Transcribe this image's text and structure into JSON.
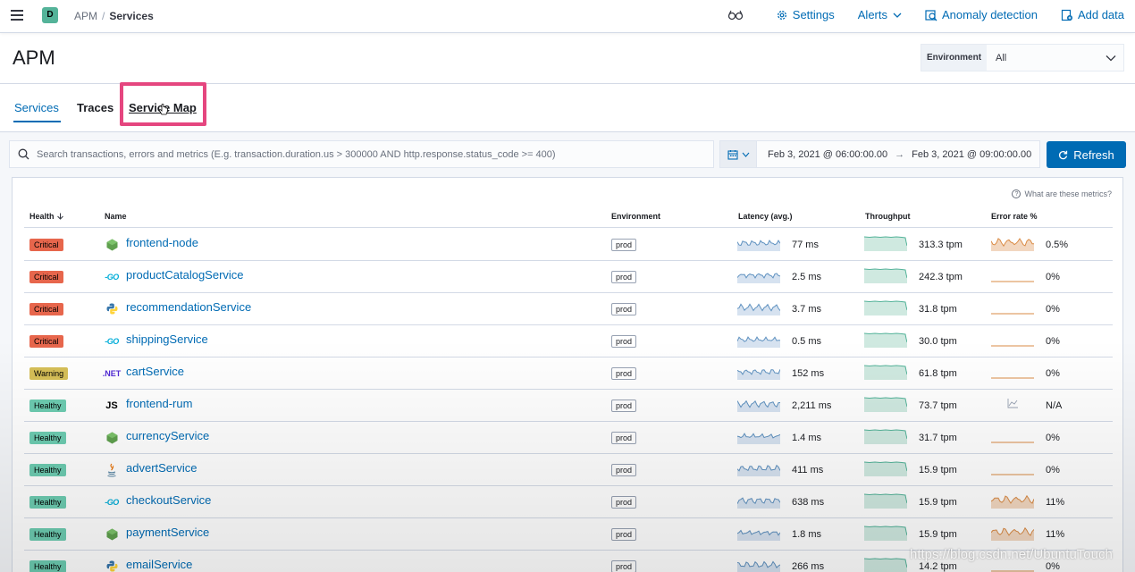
{
  "header": {
    "space_initial": "D",
    "breadcrumbs": [
      "APM",
      "Services"
    ],
    "settings": "Settings",
    "alerts": "Alerts",
    "anomaly": "Anomaly detection",
    "add_data": "Add data"
  },
  "page": {
    "title": "APM",
    "environment_label": "Environment",
    "environment_value": "All"
  },
  "tabs": {
    "services": "Services",
    "traces": "Traces",
    "service_map": "Service Map"
  },
  "search": {
    "placeholder": "Search transactions, errors and metrics (E.g. transaction.duration.us > 300000 AND http.response.status_code >= 400)"
  },
  "datepicker": {
    "start": "Feb 3, 2021 @ 06:00:00.00",
    "end": "Feb 3, 2021 @ 09:00:00.00"
  },
  "refresh_label": "Refresh",
  "metrics_help": "What are these metrics?",
  "table": {
    "columns": {
      "health": "Health",
      "name": "Name",
      "environment": "Environment",
      "latency": "Latency (avg.)",
      "throughput": "Throughput",
      "error_rate": "Error rate %"
    },
    "rows": [
      {
        "health": "Critical",
        "level": "critical",
        "icon": "nodejs-icon",
        "name": "frontend-node",
        "env": "prod",
        "latency": "77 ms",
        "throughput": "313.3 tpm",
        "error": "0.5%",
        "error_spark": "wave"
      },
      {
        "health": "Critical",
        "level": "critical",
        "icon": "go-icon",
        "name": "productCatalogService",
        "env": "prod",
        "latency": "2.5 ms",
        "throughput": "242.3 tpm",
        "error": "0%",
        "error_spark": "flat"
      },
      {
        "health": "Critical",
        "level": "critical",
        "icon": "python-icon",
        "name": "recommendationService",
        "env": "prod",
        "latency": "3.7 ms",
        "throughput": "31.8 tpm",
        "error": "0%",
        "error_spark": "flat"
      },
      {
        "health": "Critical",
        "level": "critical",
        "icon": "go-icon",
        "name": "shippingService",
        "env": "prod",
        "latency": "0.5 ms",
        "throughput": "30.0 tpm",
        "error": "0%",
        "error_spark": "flat"
      },
      {
        "health": "Warning",
        "level": "warning",
        "icon": "dotnet-icon",
        "name": "cartService",
        "env": "prod",
        "latency": "152 ms",
        "throughput": "61.8 tpm",
        "error": "0%",
        "error_spark": "flat"
      },
      {
        "health": "Healthy",
        "level": "healthy",
        "icon": "js-icon",
        "name": "frontend-rum",
        "env": "prod",
        "latency": "2,211 ms",
        "throughput": "73.7 tpm",
        "error": "N/A",
        "error_spark": "none"
      },
      {
        "health": "Healthy",
        "level": "healthy",
        "icon": "nodejs-icon",
        "name": "currencyService",
        "env": "prod",
        "latency": "1.4 ms",
        "throughput": "31.7 tpm",
        "error": "0%",
        "error_spark": "flat"
      },
      {
        "health": "Healthy",
        "level": "healthy",
        "icon": "java-icon",
        "name": "advertService",
        "env": "prod",
        "latency": "411 ms",
        "throughput": "15.9 tpm",
        "error": "0%",
        "error_spark": "flat"
      },
      {
        "health": "Healthy",
        "level": "healthy",
        "icon": "go-icon",
        "name": "checkoutService",
        "env": "prod",
        "latency": "638 ms",
        "throughput": "15.9 tpm",
        "error": "11%",
        "error_spark": "wave"
      },
      {
        "health": "Healthy",
        "level": "healthy",
        "icon": "nodejs-icon",
        "name": "paymentService",
        "env": "prod",
        "latency": "1.8 ms",
        "throughput": "15.9 tpm",
        "error": "11%",
        "error_spark": "wave"
      },
      {
        "health": "Healthy",
        "level": "healthy",
        "icon": "python-icon",
        "name": "emailService",
        "env": "prod",
        "latency": "266 ms",
        "throughput": "14.2 tpm",
        "error": "0%",
        "error_spark": "flat"
      }
    ]
  },
  "watermark": "https://blog.csdn.net/UbuntuTouch"
}
